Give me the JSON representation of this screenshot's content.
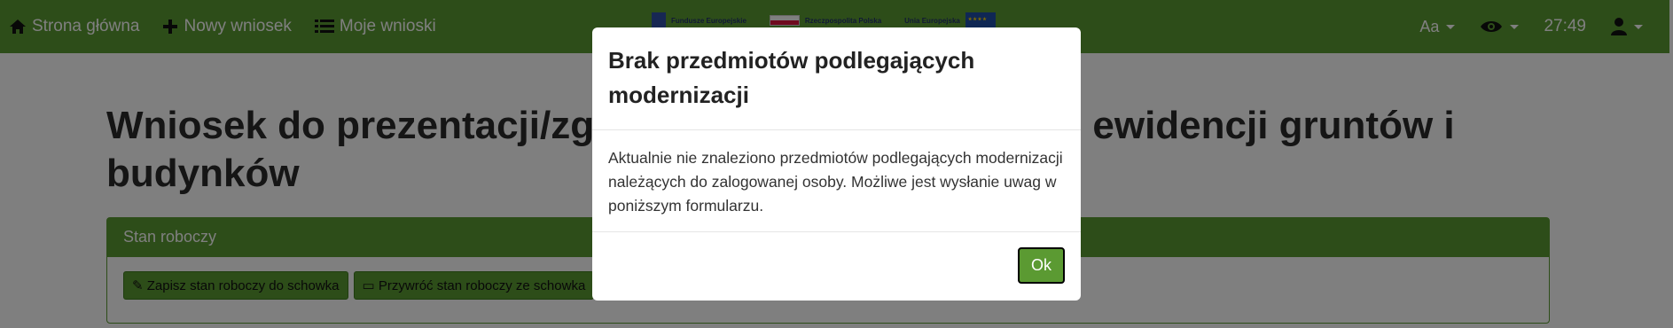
{
  "nav": {
    "home_label": "Strona główna",
    "new_label": "Nowy wniosek",
    "my_label": "Moje wnioski",
    "logos": {
      "funds": "Fundusze Europejskie",
      "rp": "Rzeczpospolita Polska",
      "eu": "Unia Europejska"
    },
    "font_size_label": "Aa",
    "timer": "27:49"
  },
  "page": {
    "title": "Wniosek do prezentacji/zgłoszenia uwag do projektu ewidencji gruntów i budynków",
    "card_header": "Stan roboczy",
    "save_draft_label": "Zapisz stan roboczy do schowka",
    "restore_draft_label": "Przywróć stan roboczy ze schowka"
  },
  "modal": {
    "title": "Brak przedmiotów podlegających modernizacji",
    "body": "Aktualnie nie znaleziono przedmiotów podlegających modernizacji należących do zalogowanej osoby. Możliwe jest wysłanie uwag w poniższym formularzu.",
    "ok_label": "Ok"
  },
  "colors": {
    "brand_green": "#5b9a32"
  }
}
